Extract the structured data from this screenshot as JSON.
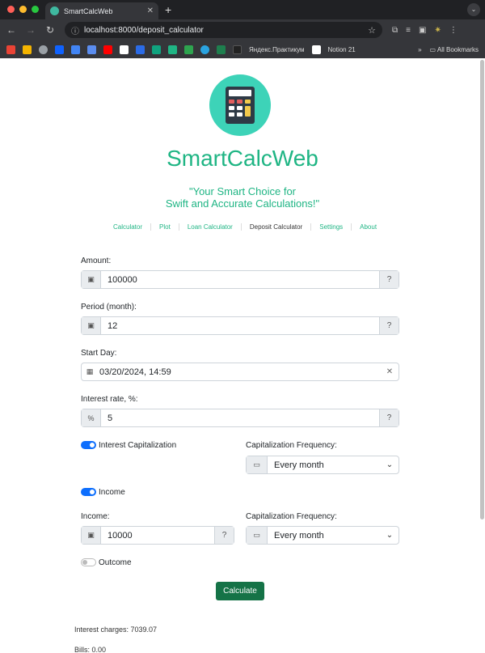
{
  "browser": {
    "tab_title": "SmartCalcWeb",
    "new_tab": "+",
    "url": "localhost:8000/deposit_calculator",
    "bookmarks": [
      {
        "label": "Яндекс.Практикум"
      },
      {
        "label": "Notion 21"
      }
    ],
    "all_bookmarks": "All Bookmarks",
    "more": "»"
  },
  "app": {
    "brand": "SmartCalcWeb",
    "tagline_line1": "\"Your Smart Choice for",
    "tagline_line2": "Swift and Accurate Calculations!\"",
    "nav": [
      {
        "label": "Calculator"
      },
      {
        "label": "Plot"
      },
      {
        "label": "Loan Calculator"
      },
      {
        "label": "Deposit Calculator",
        "active": true
      },
      {
        "label": "Settings"
      },
      {
        "label": "About"
      }
    ]
  },
  "form": {
    "amount": {
      "label": "Amount:",
      "value": "100000"
    },
    "period": {
      "label": "Period (month):",
      "value": "12"
    },
    "start_day": {
      "label": "Start Day:",
      "value": "03/20/2024, 14:59"
    },
    "interest_rate": {
      "label": "Interest rate, %:",
      "prefix": "%",
      "value": "5"
    },
    "capitalization": {
      "label": "Interest Capitalization",
      "on": true
    },
    "cap_frequency": {
      "label": "Capitalization Frequency:",
      "value": "Every month"
    },
    "income_toggle": {
      "label": "Income",
      "on": true
    },
    "income": {
      "label": "Income:",
      "value": "10000"
    },
    "income_frequency": {
      "label": "Capitalization Frequency:",
      "value": "Every month"
    },
    "outcome_toggle": {
      "label": "Outcome",
      "on": false
    },
    "calculate": "Calculate"
  },
  "results": {
    "interest_charges": "Interest charges: 7039.07",
    "bills": "Bills: 0.00"
  }
}
